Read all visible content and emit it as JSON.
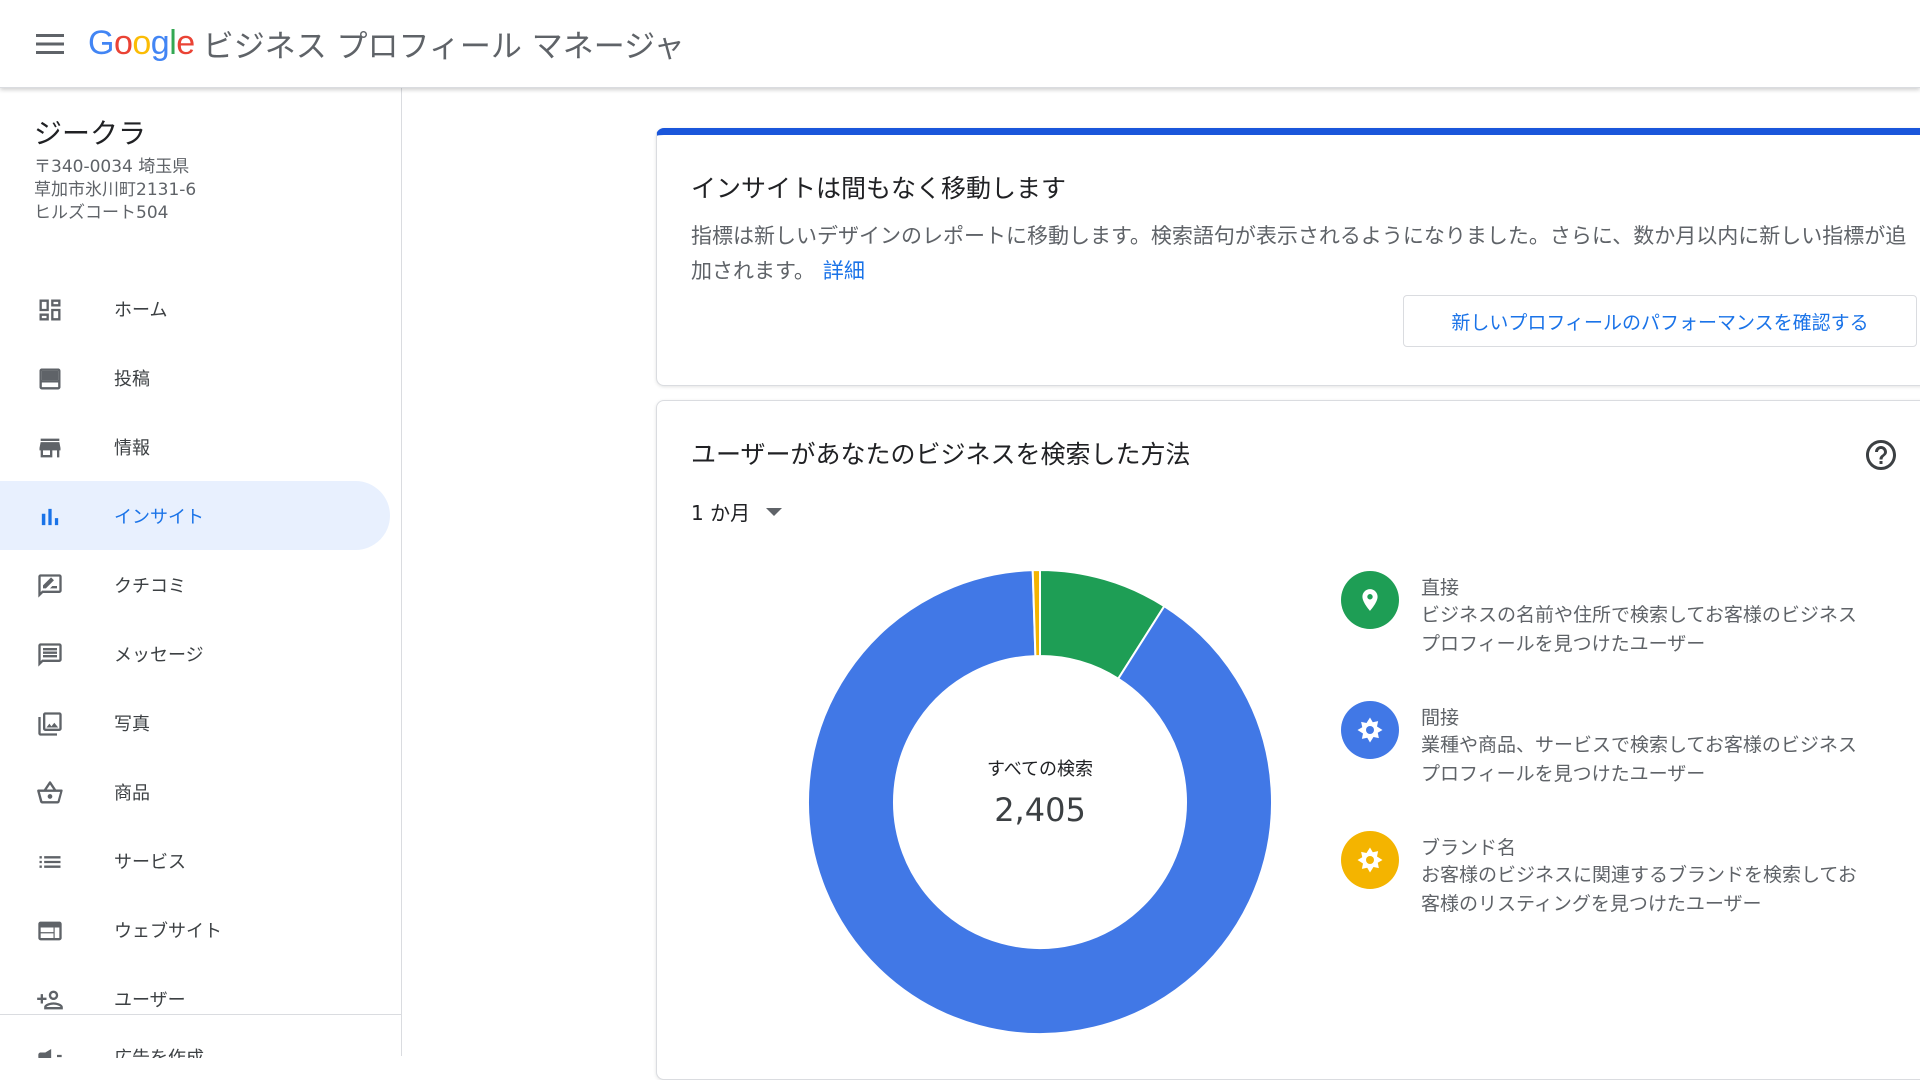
{
  "header": {
    "logo_letters": [
      "G",
      "o",
      "o",
      "g",
      "l",
      "e"
    ],
    "product_name": "ビジネス プロフィール マネージャ"
  },
  "sidebar": {
    "business_name": "ジークラ",
    "address_lines": [
      "〒340-0034 埼玉県",
      "草加市氷川町2131-6",
      "ヒルズコート504"
    ],
    "items": [
      {
        "label": "ホーム",
        "icon": "dashboard-icon"
      },
      {
        "label": "投稿",
        "icon": "posts-icon"
      },
      {
        "label": "情報",
        "icon": "storefront-icon"
      },
      {
        "label": "インサイト",
        "icon": "bar-chart-icon",
        "active": true
      },
      {
        "label": "クチコミ",
        "icon": "rate-review-icon"
      },
      {
        "label": "メッセージ",
        "icon": "message-icon"
      },
      {
        "label": "写真",
        "icon": "photo-library-icon"
      },
      {
        "label": "商品",
        "icon": "shopping-basket-icon"
      },
      {
        "label": "サービス",
        "icon": "list-icon"
      },
      {
        "label": "ウェブサイト",
        "icon": "web-icon"
      },
      {
        "label": "ユーザー",
        "icon": "person-add-icon"
      }
    ],
    "partial_item_label": "広告を作成"
  },
  "notice_card": {
    "title": "インサイトは間もなく移動します",
    "body": "指標は新しいデザインのレポートに移動します。検索語句が表示されるようになりました。さらに、数か月以内に新しい指標が追加されます。",
    "link": "詳細",
    "button": "新しいプロフィールのパフォーマンスを確認する",
    "accent_color": "#1a56db"
  },
  "search_card": {
    "title": "ユーザーがあなたのビジネスを検索した方法",
    "period": "1 か月",
    "center_label": "すべての検索",
    "center_value": "2,405",
    "legend": [
      {
        "title": "直接",
        "desc": "ビジネスの名前や住所で検索してお客様のビジネス プロフィールを見つけたユーザー",
        "color": "#1e9e55",
        "icon": "location-pin-icon"
      },
      {
        "title": "間接",
        "desc": "業種や商品、サービスで検索してお客様のビジネス プロフィールを見つけたユーザー",
        "color": "#4178e6",
        "icon": "discovery-icon"
      },
      {
        "title": "ブランド名",
        "desc": "お客様のビジネスに関連するブランドを検索してお客様のリスティングを見つけたユーザー",
        "color": "#f4b400",
        "icon": "brand-icon"
      }
    ]
  },
  "chart_data": {
    "type": "pie",
    "categories": [
      "直接",
      "間接",
      "ブランド名"
    ],
    "values": [
      9,
      90.5,
      0.5
    ],
    "colors": [
      "#1e9e55",
      "#4178e6",
      "#f4b400"
    ],
    "start_angle_deg": 0,
    "donut": true
  }
}
